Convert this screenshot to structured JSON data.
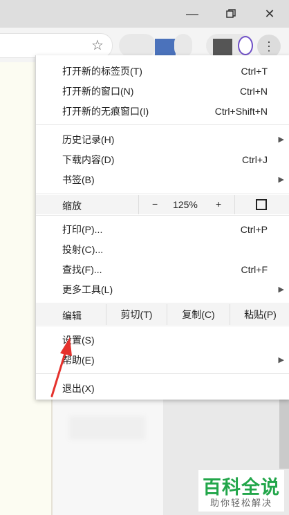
{
  "window": {
    "minimize_label": "—",
    "restore_icon": "restore-icon",
    "close_label": "✕"
  },
  "toolbar": {
    "star": "☆",
    "menu_dots": "⋮"
  },
  "menu": {
    "group1": [
      {
        "label": "打开新的标签页(T)",
        "shortcut": "Ctrl+T"
      },
      {
        "label": "打开新的窗口(N)",
        "shortcut": "Ctrl+N"
      },
      {
        "label": "打开新的无痕窗口(I)",
        "shortcut": "Ctrl+Shift+N"
      }
    ],
    "group2": [
      {
        "label": "历史记录(H)",
        "shortcut": ""
      },
      {
        "label": "下载内容(D)",
        "shortcut": "Ctrl+J"
      },
      {
        "label": "书签(B)",
        "shortcut": ""
      }
    ],
    "zoom": {
      "label": "缩放",
      "minus": "−",
      "value": "125%",
      "plus": "+"
    },
    "group3": [
      {
        "label": "打印(P)...",
        "shortcut": "Ctrl+P"
      },
      {
        "label": "投射(C)...",
        "shortcut": ""
      },
      {
        "label": "查找(F)...",
        "shortcut": "Ctrl+F"
      },
      {
        "label": "更多工具(L)",
        "shortcut": ""
      }
    ],
    "edit": {
      "label": "编辑",
      "cut": "剪切(T)",
      "copy": "复制(C)",
      "paste": "粘贴(P)"
    },
    "group4": [
      {
        "label": "设置(S)"
      },
      {
        "label": "帮助(E)"
      }
    ],
    "exit": {
      "label": "退出(X)"
    },
    "submenu_arrow": "▶"
  },
  "watermark": {
    "title": "百科全说",
    "subtitle": "助你轻松解决"
  },
  "colors": {
    "annotation_arrow": "#e5322d",
    "watermark_green": "#22a64a"
  }
}
